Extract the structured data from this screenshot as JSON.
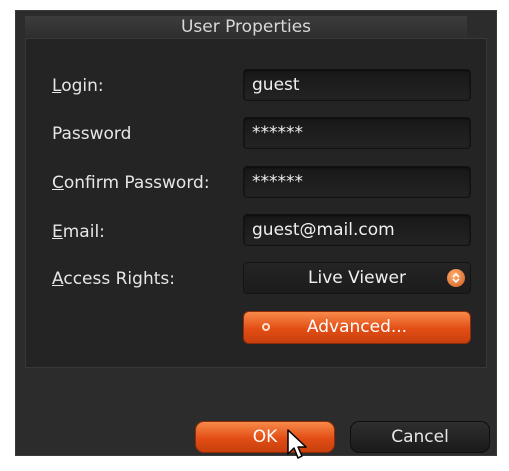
{
  "dialog": {
    "title": "User Properties",
    "fields": {
      "login": {
        "label_ul": "L",
        "label_rest": "ogin:",
        "value": "guest"
      },
      "password": {
        "label": "Password",
        "value": "******"
      },
      "confirm": {
        "label_ul": "C",
        "label_rest": "onfirm Password:",
        "value": "******"
      },
      "email": {
        "label_ul": "E",
        "label_rest": "mail:",
        "value": "guest@mail.com"
      },
      "access": {
        "label_ul": "A",
        "label_rest": "ccess Rights:",
        "value": "Live Viewer"
      }
    },
    "advanced_label": "Advanced...",
    "ok_label": "OK",
    "cancel_label": "Cancel"
  },
  "colors": {
    "accent": "#e24d14",
    "background": "#2c2c2c"
  },
  "icons": {
    "dropdown": "chevron-updown-icon",
    "cursor": "mouse-pointer-icon",
    "radio": "radio-dot-icon"
  }
}
